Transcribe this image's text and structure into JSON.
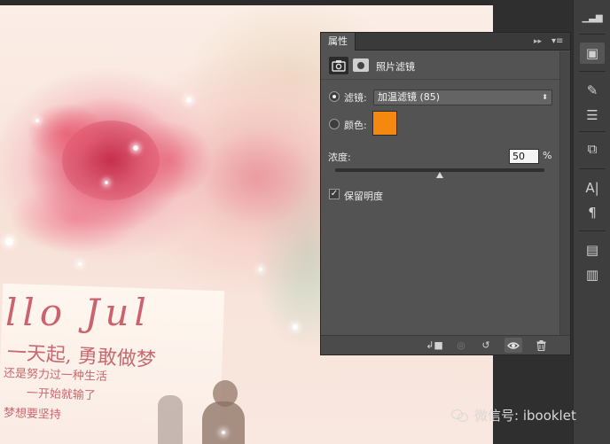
{
  "panel": {
    "tab_label": "属性",
    "collapse_glyph": "▸▸",
    "menu_glyph": "▾≡",
    "adjustment_title": "照片滤镜",
    "filter_label": "滤镜:",
    "filter_value": "加温滤镜 (85)",
    "filter_arrow": "⬍",
    "color_label": "颜色:",
    "color_value": "#f5890f",
    "density_label": "浓度:",
    "density_value": "50",
    "density_unit": "%",
    "density_level": 0.5,
    "preserve_label": "保留明度",
    "preserve_checked": true,
    "preserve_check_glyph": "✓",
    "selected_option": "filter"
  },
  "footer": {
    "clip_glyph": "↲■",
    "view_prev_glyph": "◎",
    "reset_glyph": "↺",
    "visibility_glyph": "👁",
    "delete_glyph": "🗑"
  },
  "toolbar": {
    "items": [
      {
        "name": "histogram-icon",
        "glyph": "▁▃▆"
      },
      {
        "name": "adjustments-icon",
        "glyph": "▣"
      },
      {
        "name": "brushes-icon",
        "glyph": "✎"
      },
      {
        "name": "sliders-icon",
        "glyph": "☰"
      },
      {
        "name": "clone-source-icon",
        "glyph": "⧉"
      },
      {
        "name": "character-icon",
        "glyph": "A|"
      },
      {
        "name": "paragraph-icon",
        "glyph": "¶"
      },
      {
        "name": "notes-icon",
        "glyph": "▤"
      },
      {
        "name": "styles-icon",
        "glyph": "▥"
      }
    ]
  },
  "photo_text": {
    "script": "llo Jul",
    "cn_line_1": "一天起, 勇敢做梦",
    "cn_line_2": "一开始就输了",
    "cn_line_3": "还是努力过一种生活",
    "cn_line_4": "梦想要坚持"
  },
  "watermark": {
    "text": "微信号: ibooklet"
  }
}
